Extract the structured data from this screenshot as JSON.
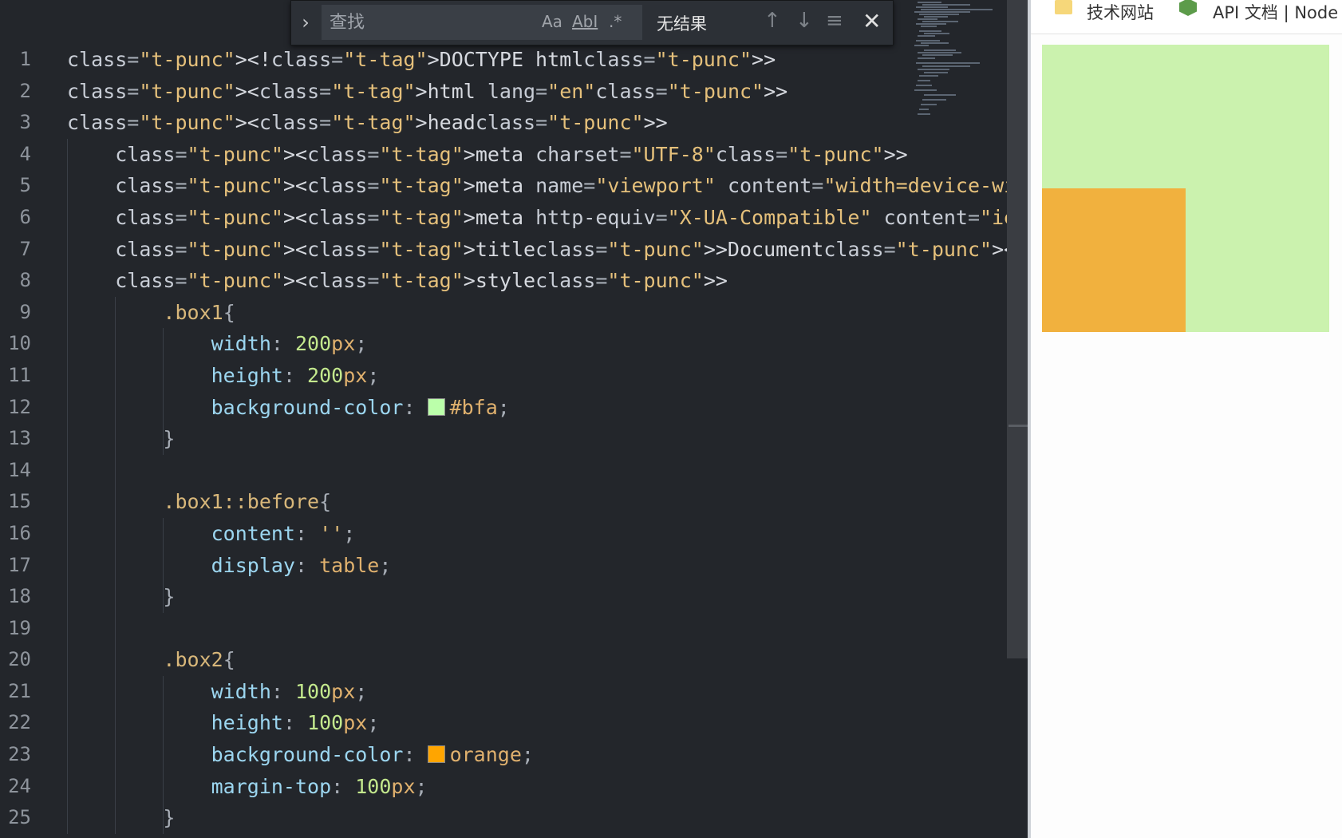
{
  "find_bar": {
    "placeholder": "查找",
    "status": "无结果",
    "toggle_icon": "chevron-right-icon",
    "options": [
      {
        "label": "Aa",
        "name": "match-case"
      },
      {
        "label": "AbI",
        "name": "match-whole-word"
      },
      {
        "label": ".*",
        "name": "regex"
      }
    ]
  },
  "editor": {
    "line_numbers": [
      "1",
      "2",
      "3",
      "4",
      "5",
      "6",
      "7",
      "8",
      "9",
      "10",
      "11",
      "12",
      "13",
      "14",
      "15",
      "16",
      "17",
      "18",
      "19",
      "20",
      "21",
      "22",
      "23",
      "24",
      "25"
    ],
    "lines": [
      "<!DOCTYPE html>",
      "<html lang=\"en\">",
      "<head>",
      "    <meta charset=\"UTF-8\">",
      "    <meta name=\"viewport\" content=\"width=device-width, initial-scal",
      "    <meta http-equiv=\"X-UA-Compatible\" content=\"ie=edge\">",
      "    <title>Document</title>",
      "    <style>",
      "        .box1{",
      "            width: 200px;",
      "            height: 200px;",
      "            background-color: #bfa;",
      "        }",
      "",
      "        .box1::before{",
      "            content: '';",
      "            display: table;",
      "        }",
      "",
      "        .box2{",
      "            width: 100px;",
      "            height: 100px;",
      "            background-color: orange;",
      "            margin-top: 100px;",
      "        }"
    ],
    "swatch_colors": {
      "bfa": "#bbffaa",
      "orange": "#ffa500"
    }
  },
  "browser": {
    "bookmarks": [
      {
        "label": "技术网站",
        "icon": "folder-icon"
      },
      {
        "label": "API 文档 | Node",
        "icon": "node-icon"
      }
    ],
    "box1_color": "#bfa",
    "box2_color": "orange"
  }
}
